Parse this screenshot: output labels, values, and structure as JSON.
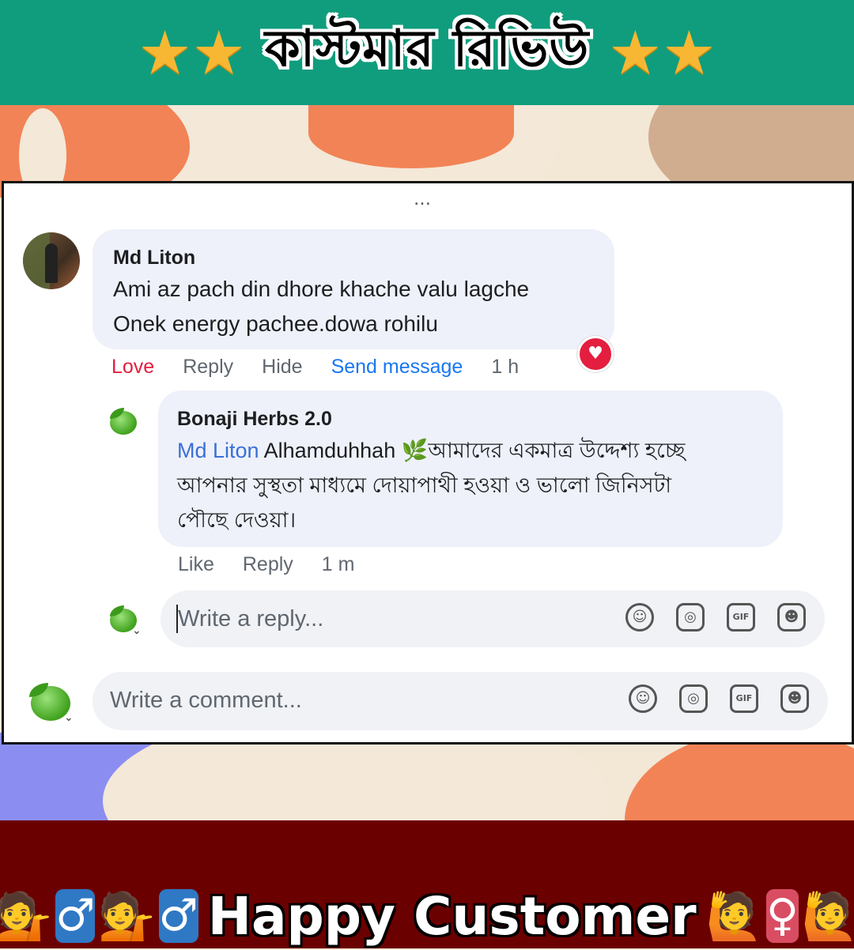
{
  "header": {
    "star_left": "★★",
    "title": "কাস্টমার রিভিউ",
    "star_right": "★★"
  },
  "post": {
    "more_icon": "…",
    "comment": {
      "author": "Md Liton",
      "lines": [
        "Ami az pach din dhore khache valu lagche",
        "Onek energy pachee.dowa rohilu"
      ],
      "reaction": "heart-icon",
      "actions": {
        "love": "Love",
        "reply": "Reply",
        "hide": "Hide",
        "send": "Send message",
        "time": "1 h"
      }
    },
    "reply": {
      "author": "Bonaji Herbs 2.0",
      "mention": "Md Liton",
      "line1_rest": "Alhamduhhah",
      "line1_bn": "আমাদের একমাত্র উদ্দেশ্য হচ্ছে",
      "line2": "আপনার সুস্থতা মাধ্যমে দোয়াপাথী হওয়া ও ভালো জিনিসটা",
      "line3": "পৌছে দেওয়া।",
      "actions": {
        "like": "Like",
        "reply": "Reply",
        "time": "1 m"
      }
    },
    "reply_box": {
      "placeholder": "Write a reply..."
    },
    "comment_box": {
      "placeholder": "Write a comment..."
    },
    "input_icons": [
      "emoji-icon",
      "camera-icon",
      "gif-icon",
      "sticker-icon"
    ]
  },
  "footer": {
    "title": "Happy Customer",
    "male_sign": "♂",
    "female_sign": "♀",
    "person_emoji": "💁",
    "raise_emoji": "🙋"
  }
}
